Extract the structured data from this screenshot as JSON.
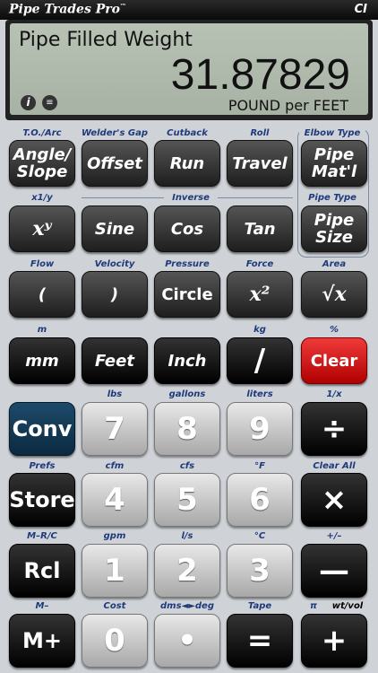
{
  "app": {
    "title": "Pipe Trades Pro",
    "title_tm": "™",
    "badge": "CI"
  },
  "display": {
    "label": "Pipe Filled Weight",
    "value": "31.87829",
    "unit": "POUND per FEET",
    "info_icon": "info-icon",
    "notes_icon": "notes-icon"
  },
  "row1": {
    "labels": [
      "T.O./Arc",
      "Welder's Gap",
      "Cutback",
      "Roll",
      "Elbow Type"
    ],
    "buttons": [
      "Angle/ Slope",
      "Offset",
      "Run",
      "Travel",
      "Pipe Mat'l"
    ]
  },
  "row2": {
    "labels": [
      "x1/y",
      "Inverse",
      "Pipe Type"
    ],
    "buttons": [
      "xʸ",
      "Sine",
      "Cos",
      "Tan",
      "Pipe Size"
    ]
  },
  "row3": {
    "labels": [
      "Flow",
      "Velocity",
      "Pressure",
      "Force",
      "Area"
    ],
    "buttons": [
      "(",
      ")",
      "Circle",
      "x²",
      "√x"
    ]
  },
  "row4": {
    "labels": [
      "m",
      "",
      "",
      "kg",
      "%"
    ],
    "buttons": [
      "mm",
      "Feet",
      "Inch",
      "/",
      "Clear"
    ]
  },
  "row5": {
    "labels": [
      "",
      "lbs",
      "gallons",
      "liters",
      "1/x"
    ],
    "buttons": [
      "Conv",
      "7",
      "8",
      "9",
      "÷"
    ]
  },
  "row6": {
    "labels": [
      "Prefs",
      "cfm",
      "cfs",
      "°F",
      "Clear All"
    ],
    "buttons": [
      "Store",
      "4",
      "5",
      "6",
      "×"
    ]
  },
  "row7": {
    "labels": [
      "M–R/C",
      "gpm",
      "l/s",
      "°C",
      "+/–"
    ],
    "buttons": [
      "Rcl",
      "1",
      "2",
      "3",
      "—"
    ]
  },
  "row8": {
    "labels": [
      "M–",
      "Cost",
      "dms◄►deg",
      "Tape",
      "π",
      "wt/vol"
    ],
    "buttons": [
      "M+",
      "0",
      "•",
      "=",
      "+"
    ]
  },
  "colors": {
    "accent_blue": "#1e3a7a",
    "clear_red": "#e02020",
    "conv_blue": "#0f3550"
  }
}
